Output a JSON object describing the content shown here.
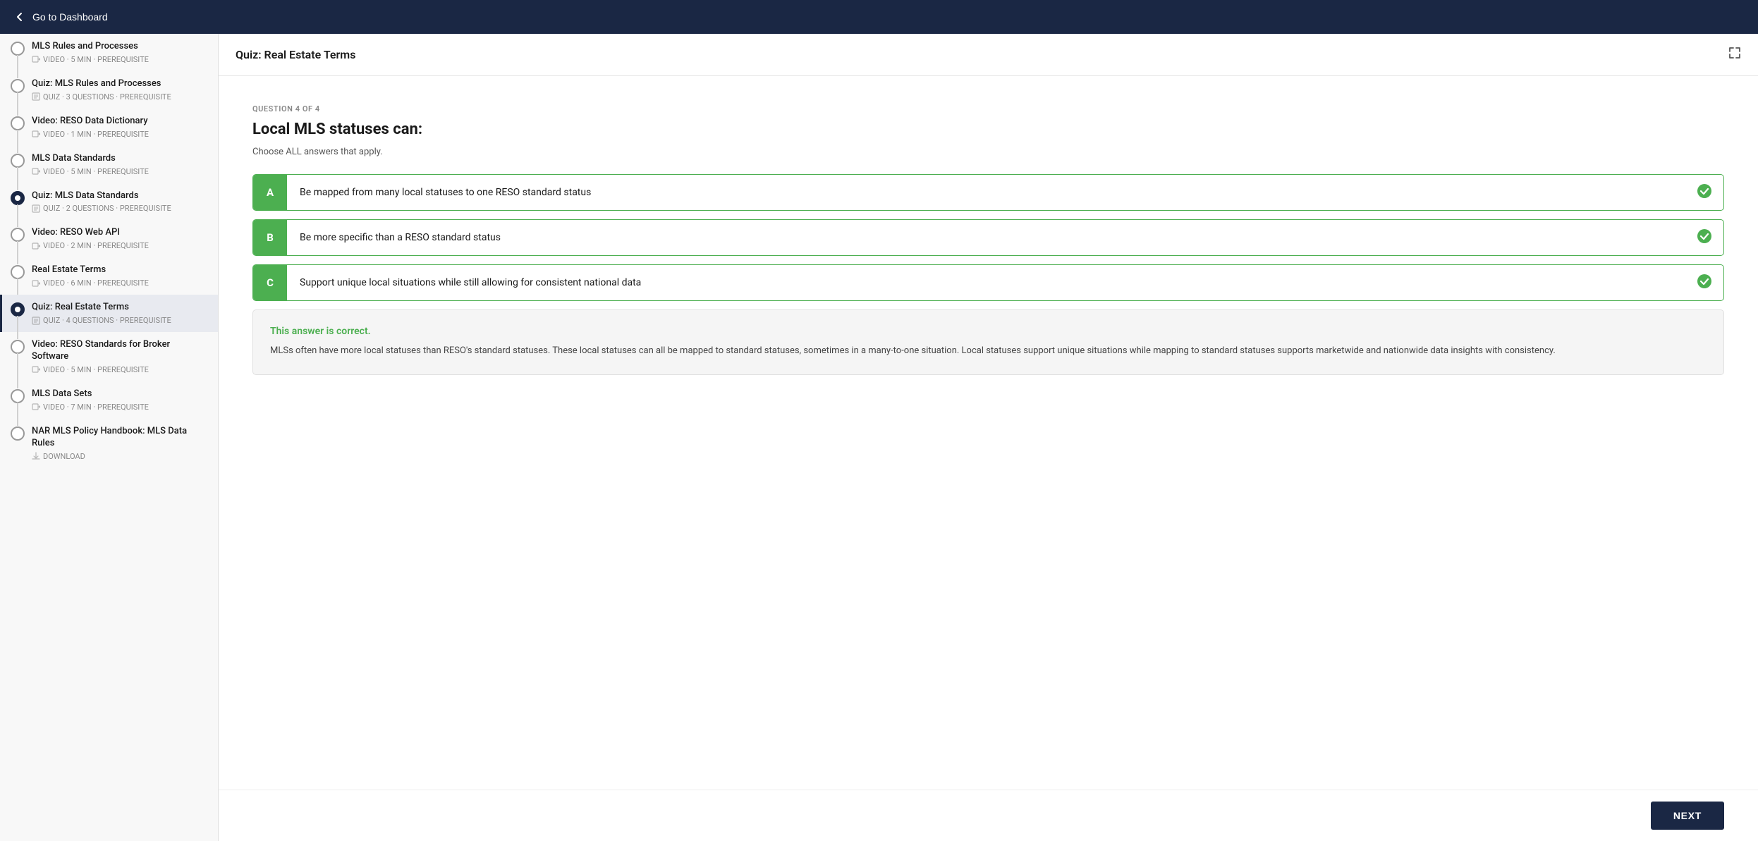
{
  "topNav": {
    "backLabel": "Go to Dashboard"
  },
  "contentHeader": {
    "title": "Quiz: Real Estate Terms"
  },
  "question": {
    "label": "QUESTION 4 OF 4",
    "text": "Local MLS statuses can:",
    "instruction": "Choose ALL answers that apply.",
    "answers": [
      {
        "letter": "A",
        "text": "Be mapped from many local statuses to one RESO standard status",
        "correct": true
      },
      {
        "letter": "B",
        "text": "Be more specific than a RESO standard status",
        "correct": true
      },
      {
        "letter": "C",
        "text": "Support unique local situations while still allowing for consistent national data",
        "correct": true
      }
    ],
    "feedbackTitle": "This answer is correct.",
    "feedbackText": "MLSs often have more local statuses than RESO's standard statuses. These local statuses can all be mapped to standard statuses, sometimes in a many-to-one situation. Local statuses support unique situations while mapping to standard statuses supports marketwide and nationwide data insights with consistency."
  },
  "nextButton": "NEXT",
  "sidebar": {
    "items": [
      {
        "title": "MLS Rules and Processes",
        "meta": "VIDEO · 5 MIN · PREREQUISITE",
        "type": "video",
        "active": false,
        "filled": false
      },
      {
        "title": "Quiz: MLS Rules and Processes",
        "meta": "QUIZ · 3 QUESTIONS · PREREQUISITE",
        "type": "quiz",
        "active": false,
        "filled": false
      },
      {
        "title": "Video: RESO Data Dictionary",
        "meta": "VIDEO · 1 MIN · PREREQUISITE",
        "type": "video",
        "active": false,
        "filled": false
      },
      {
        "title": "MLS Data Standards",
        "meta": "VIDEO · 5 MIN · PREREQUISITE",
        "type": "video",
        "active": false,
        "filled": false
      },
      {
        "title": "Quiz: MLS Data Standards",
        "meta": "QUIZ · 2 QUESTIONS · PREREQUISITE",
        "type": "quiz",
        "active": false,
        "filled": true
      },
      {
        "title": "Video: RESO Web API",
        "meta": "VIDEO · 2 MIN · PREREQUISITE",
        "type": "video",
        "active": false,
        "filled": false
      },
      {
        "title": "Real Estate Terms",
        "meta": "VIDEO · 6 MIN · PREREQUISITE",
        "type": "video",
        "active": false,
        "filled": false
      },
      {
        "title": "Quiz: Real Estate Terms",
        "meta": "QUIZ · 4 QUESTIONS · PREREQUISITE",
        "type": "quiz",
        "active": true,
        "filled": true
      },
      {
        "title": "Video: RESO Standards for Broker Software",
        "meta": "VIDEO · 5 MIN · PREREQUISITE",
        "type": "video",
        "active": false,
        "filled": false
      },
      {
        "title": "MLS Data Sets",
        "meta": "VIDEO · 7 MIN · PREREQUISITE",
        "type": "video",
        "active": false,
        "filled": false
      },
      {
        "title": "NAR MLS Policy Handbook: MLS Data Rules",
        "meta": "DOWNLOAD",
        "type": "download",
        "active": false,
        "filled": false
      }
    ]
  },
  "colors": {
    "correct": "#4CAF50",
    "navBg": "#1a2744",
    "activeSidebarBg": "#e8eaf0"
  }
}
